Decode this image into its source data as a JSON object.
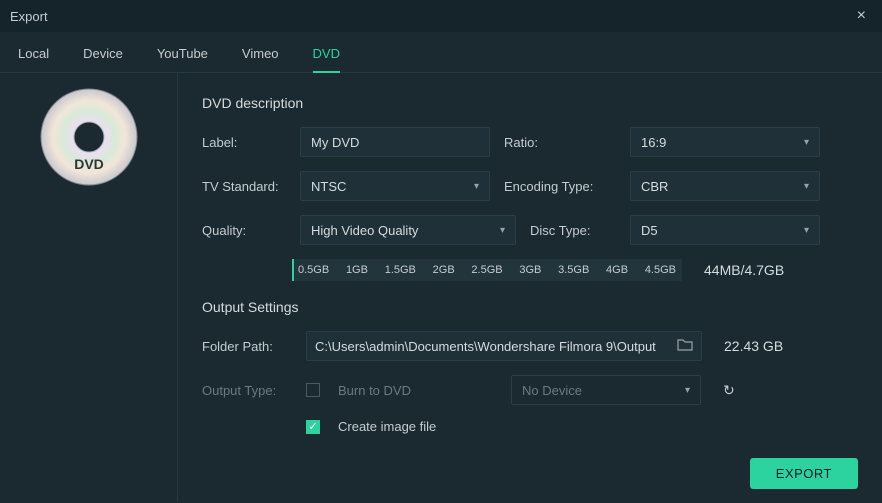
{
  "window": {
    "title": "Export"
  },
  "tabs": {
    "local": "Local",
    "device": "Device",
    "youtube": "YouTube",
    "vimeo": "Vimeo",
    "dvd": "DVD"
  },
  "dvd": {
    "section_title": "DVD description",
    "label_label": "Label:",
    "label_value": "My DVD",
    "ratio_label": "Ratio:",
    "ratio_value": "16:9",
    "tvstd_label": "TV Standard:",
    "tvstd_value": "NTSC",
    "enctype_label": "Encoding Type:",
    "enctype_value": "CBR",
    "quality_label": "Quality:",
    "quality_value": "High Video Quality",
    "disctype_label": "Disc Type:",
    "disctype_value": "D5",
    "size_labels": [
      "0.5GB",
      "1GB",
      "1.5GB",
      "2GB",
      "2.5GB",
      "3GB",
      "3.5GB",
      "4GB",
      "4.5GB"
    ],
    "size_readout": "44MB/4.7GB"
  },
  "output": {
    "section_title": "Output Settings",
    "folder_label": "Folder Path:",
    "folder_value": "C:\\Users\\admin\\Documents\\Wondershare Filmora 9\\Output",
    "free_space": "22.43 GB",
    "output_type_label": "Output Type:",
    "burn_label": "Burn to DVD",
    "device_value": "No Device",
    "image_label": "Create image file"
  },
  "actions": {
    "export": "EXPORT"
  }
}
